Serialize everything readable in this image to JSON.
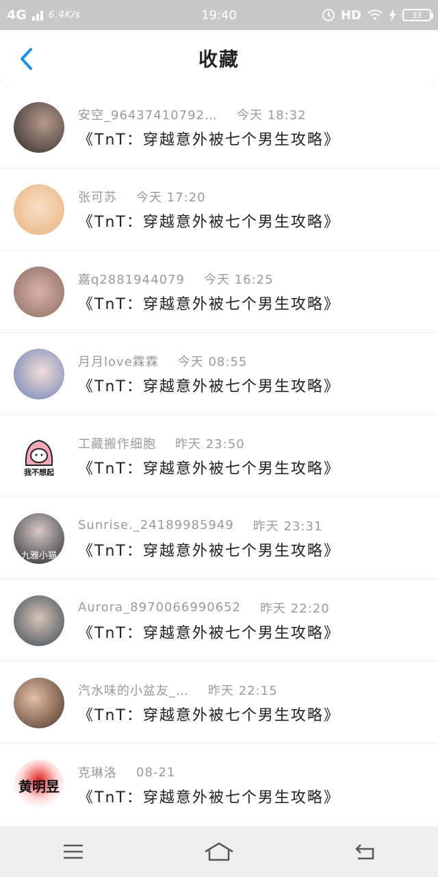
{
  "status_bar": {
    "network": "4G",
    "speed": "6.4K/s",
    "time": "19:40",
    "hd": "HD",
    "battery": "33"
  },
  "header": {
    "title": "收藏"
  },
  "favorites": [
    {
      "user": "安空_96437410792…",
      "time": "今天 18:32",
      "title": "《TnT：穿越意外被七个男生攻略》"
    },
    {
      "user": "张可苏",
      "time": "今天 17:20",
      "title": "《TnT：穿越意外被七个男生攻略》"
    },
    {
      "user": "嘉q2881944079",
      "time": "今天 16:25",
      "title": "《TnT：穿越意外被七个男生攻略》"
    },
    {
      "user": "月月love霖霖",
      "time": "今天 08:55",
      "title": "《TnT：穿越意外被七个男生攻略》"
    },
    {
      "user": "工藏搬作细胞",
      "time": "昨天 23:50",
      "title": "《TnT：穿越意外被七个男生攻略》",
      "avatar_text": "我不想起"
    },
    {
      "user": "Sunrise._2418998​5949",
      "time": "昨天 23:31",
      "title": "《TnT：穿越意外被七个男生攻略》",
      "avatar_text": "九雅小猫"
    },
    {
      "user": "Aurora_8970066990652",
      "time": "昨天 22:20",
      "title": "《TnT：穿越意外被七个男生攻略》"
    },
    {
      "user": "汽水味的小盆友_…",
      "time": "昨天 22:15",
      "title": "《TnT：穿越意外被七个男生攻略》"
    },
    {
      "user": "克琳洛",
      "time": "08-21",
      "title": "《TnT：穿越意外被七个男生攻略》",
      "avatar_text": "黄明昱"
    }
  ],
  "colors": {
    "accent": "#1e8fe8",
    "status_bar_bg": "#c8c8c8",
    "nav_bg": "#eeeeee"
  },
  "icons": {
    "back": "back-arrow-icon",
    "menu": "menu-icon",
    "home": "home-icon",
    "return": "return-icon"
  }
}
